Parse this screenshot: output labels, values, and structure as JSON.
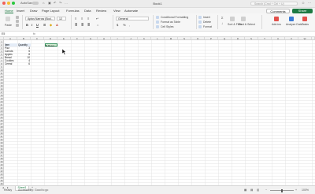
{
  "window": {
    "autosave_label": "AutoSave",
    "title": "Book1",
    "search_placeholder": "Search (Cmd + Ctrl + U)"
  },
  "ribbon_tabs": [
    "Home",
    "Insert",
    "Draw",
    "Page Layout",
    "Formulas",
    "Data",
    "Review",
    "View",
    "Automate"
  ],
  "active_tab": "Home",
  "buttons": {
    "comments": "Comments",
    "share": "Share"
  },
  "ribbon": {
    "paste": "Paste",
    "font_name": "Aptos Narrow (Bod...",
    "font_size": "12",
    "number_format": "General",
    "conditional_formatting": "Conditional Formatting",
    "format_as_table": "Format as Table",
    "cell_styles": "Cell Styles",
    "insert": "Insert",
    "delete": "Delete",
    "format": "Format",
    "sort_filter": "Sort & Filter",
    "find_select": "Find & Select",
    "addins": "Add-ins",
    "analyze_data": "Analyze Data",
    "tasks": "Tasks"
  },
  "formula_bar": {
    "name_box": "E5",
    "fx": "fx"
  },
  "columns": [
    "A",
    "B",
    "C",
    "D",
    "E",
    "F",
    "G",
    "H",
    "I",
    "J",
    "K",
    "L",
    "M",
    "N",
    "O",
    "P",
    "Q",
    "R",
    "S",
    "T",
    "U",
    "V",
    "W",
    "X"
  ],
  "table": {
    "headers": [
      "Item",
      "Quantity"
    ],
    "rows": [
      [
        "Pizz",
        "3"
      ],
      [
        "Carrots",
        "5"
      ],
      [
        "Apples",
        "8"
      ],
      [
        "Bread",
        "10"
      ],
      [
        "Cookies",
        "4"
      ],
      [
        "Cereal",
        "6"
      ]
    ],
    "reset_label": "R Reset"
  },
  "sheet_tab": "Sheet1",
  "status": {
    "ready": "Ready",
    "accessibility": "Accessibility: Good to go",
    "zoom": "100%"
  },
  "colors": {
    "accent": "#1e7a43"
  }
}
